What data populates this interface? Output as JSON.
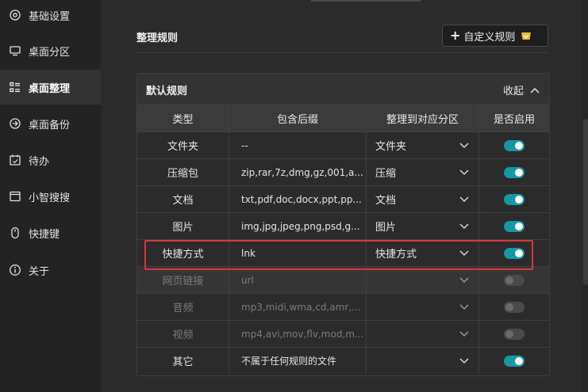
{
  "sidebar": {
    "items": [
      {
        "label": "基础设置",
        "icon": "gear-icon"
      },
      {
        "label": "桌面分区",
        "icon": "monitor-icon"
      },
      {
        "label": "桌面整理",
        "icon": "list-icon",
        "active": true
      },
      {
        "label": "桌面备份",
        "icon": "backup-icon"
      },
      {
        "label": "待办",
        "icon": "calendar-icon"
      },
      {
        "label": "小智搜搜",
        "icon": "window-icon"
      },
      {
        "label": "快捷键",
        "icon": "mouse-icon"
      },
      {
        "label": "关于",
        "icon": "info-icon"
      }
    ]
  },
  "main": {
    "section_title": "整理规则",
    "custom_rule_button": "自定义规则",
    "panel": {
      "title": "默认规则",
      "collapse_label": "收起",
      "columns": [
        "类型",
        "包含后缀",
        "整理到对应分区",
        "是否启用"
      ],
      "rows": [
        {
          "type": "文件夹",
          "suffix": "--",
          "partition": "文件夹",
          "enabled": true,
          "disabled": false
        },
        {
          "type": "压缩包",
          "suffix": "zip,rar,7z,dmg,gz,001,a...",
          "partition": "压缩",
          "enabled": true,
          "disabled": false
        },
        {
          "type": "文档",
          "suffix": "txt,pdf,doc,docx,ppt,pp...",
          "partition": "文档",
          "enabled": true,
          "disabled": false
        },
        {
          "type": "图片",
          "suffix": "img,jpg,jpeg,png,psd,g...",
          "partition": "图片",
          "enabled": true,
          "disabled": false
        },
        {
          "type": "快捷方式",
          "suffix": "lnk",
          "partition": "快捷方式",
          "enabled": true,
          "disabled": false
        },
        {
          "type": "网页链接",
          "suffix": "url",
          "partition": "",
          "enabled": false,
          "disabled": true
        },
        {
          "type": "音频",
          "suffix": "mp3,midi,wma,cd,amr,...",
          "partition": "",
          "enabled": false,
          "disabled": true
        },
        {
          "type": "视频",
          "suffix": "mp4,avi,mov,flv,mod,m...",
          "partition": "",
          "enabled": false,
          "disabled": true
        },
        {
          "type": "其它",
          "suffix": "不属于任何规则的文件",
          "partition": "",
          "enabled": true,
          "disabled": false
        }
      ]
    }
  },
  "colors": {
    "accent": "#1597a6",
    "highlight_border": "#d9363b",
    "vip_badge": "#e8b73a"
  }
}
